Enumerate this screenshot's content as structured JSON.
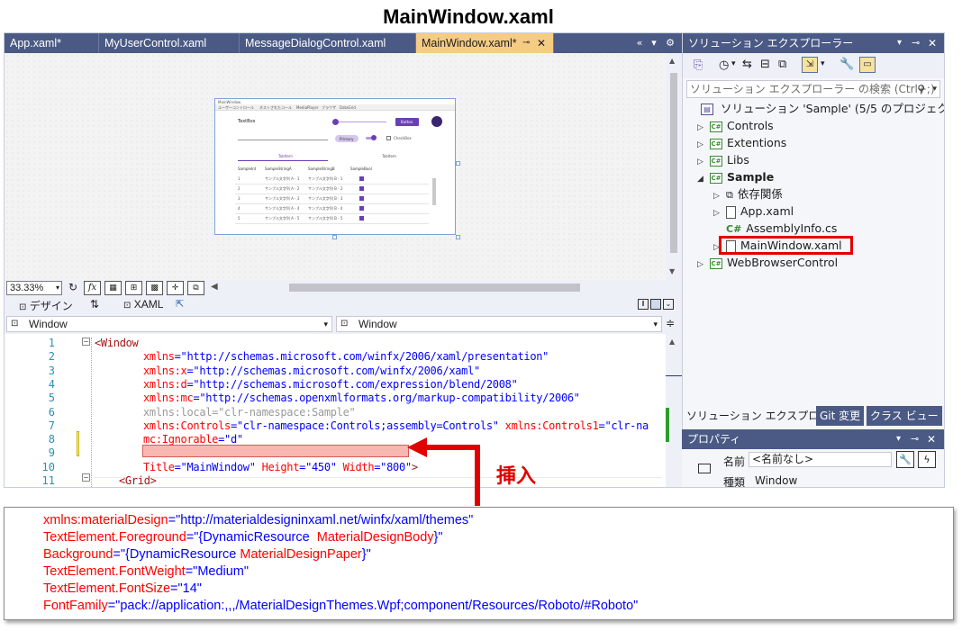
{
  "heading": "MainWindow.xaml",
  "doc_tabs": [
    {
      "label": "App.xaml*",
      "active": false
    },
    {
      "label": "MyUserControl.xaml",
      "active": false
    },
    {
      "label": "MessageDialogControl.xaml",
      "active": false
    },
    {
      "label": "MainWindow.xaml*",
      "active": true
    }
  ],
  "designer_preview": {
    "title": "MainWindow",
    "tabs": [
      "ユーザーコントロール",
      "ネストされたコール",
      "MediaPlayer",
      "ブラウザ",
      "DataGrid"
    ],
    "textbox_label": "TextBox",
    "button_label": "Button",
    "chip_label": "Primary",
    "checkbox_label": "CheckBox",
    "tab_items": [
      "TabItem",
      "TabItem"
    ],
    "grid_headers": [
      "SampleInt",
      "SampleStringA",
      "SampleStringB",
      "SampleBool"
    ],
    "grid_rows": [
      [
        "1",
        "サンプル文字列 A - 1",
        "サンプル文字列 B - 1"
      ],
      [
        "2",
        "サンプル文字列 A - 2",
        "サンプル文字列 B - 2"
      ],
      [
        "3",
        "サンプル文字列 A - 3",
        "サンプル文字列 B - 3"
      ],
      [
        "4",
        "サンプル文字列 A - 4",
        "サンプル文字列 B - 4"
      ],
      [
        "5",
        "サンプル文字列 A - 5",
        "サンプル文字列 B - 5"
      ]
    ]
  },
  "zoom_level": "33.33%",
  "view_tabs": {
    "design": "デザイン",
    "xaml": "XAML"
  },
  "dropdowns": {
    "left": "Window",
    "right": "Window"
  },
  "code_lines": [
    {
      "n": "1",
      "parts": [
        {
          "c": "kw",
          "t": "<Window"
        }
      ]
    },
    {
      "n": "2",
      "parts": [
        {
          "c": "at",
          "t": "xmlns"
        },
        {
          "c": "st",
          "t": "=\"http://schemas.microsoft.com/winfx/2006/xaml/presentation\""
        }
      ]
    },
    {
      "n": "3",
      "parts": [
        {
          "c": "at",
          "t": "xmlns:x"
        },
        {
          "c": "st",
          "t": "=\"http://schemas.microsoft.com/winfx/2006/xaml\""
        }
      ]
    },
    {
      "n": "4",
      "parts": [
        {
          "c": "at",
          "t": "xmlns:d"
        },
        {
          "c": "st",
          "t": "=\"http://schemas.microsoft.com/expression/blend/2008\""
        }
      ]
    },
    {
      "n": "5",
      "parts": [
        {
          "c": "at",
          "t": "xmlns:mc"
        },
        {
          "c": "st",
          "t": "=\"http://schemas.openxmlformats.org/markup-compatibility/2006\""
        }
      ]
    },
    {
      "n": "6",
      "parts": [
        {
          "c": "gr",
          "t": "xmlns:local=\"clr-namespace:Sample\""
        }
      ]
    },
    {
      "n": "7",
      "parts": [
        {
          "c": "at",
          "t": "xmlns:Controls"
        },
        {
          "c": "st",
          "t": "=\"clr-namespace:Controls;assembly=Controls\" "
        },
        {
          "c": "at",
          "t": "xmlns:Controls1"
        },
        {
          "c": "st",
          "t": "=\"clr-na"
        }
      ]
    },
    {
      "n": "8",
      "parts": [
        {
          "c": "at",
          "t": "mc:Ignorable"
        },
        {
          "c": "st",
          "t": "=\"d\""
        }
      ]
    },
    {
      "n": "9",
      "parts": []
    },
    {
      "n": "10",
      "parts": [
        {
          "c": "at",
          "t": "Title"
        },
        {
          "c": "st",
          "t": "=\"MainWindow\" "
        },
        {
          "c": "at",
          "t": "Height"
        },
        {
          "c": "st",
          "t": "=\"450\" "
        },
        {
          "c": "at",
          "t": "Width"
        },
        {
          "c": "st",
          "t": "=\"800\""
        },
        {
          "c": "kw",
          "t": ">"
        }
      ]
    },
    {
      "n": "11",
      "parts": [
        {
          "c": "kw",
          "t": "<Grid>"
        }
      ]
    }
  ],
  "solution_explorer": {
    "title": "ソリューション エクスプローラー",
    "search_placeholder": "ソリューション エクスプローラー の検索 (Ctrl+;)",
    "solution_label": "ソリューション 'Sample' (5/5 のプロジェクト)",
    "items": [
      {
        "label": "Controls",
        "indent": 0,
        "kind": "project",
        "expander": "▷"
      },
      {
        "label": "Extentions",
        "indent": 0,
        "kind": "project",
        "expander": "▷"
      },
      {
        "label": "Libs",
        "indent": 0,
        "kind": "project",
        "expander": "▷"
      },
      {
        "label": "Sample",
        "indent": 0,
        "kind": "project",
        "expander": "◢",
        "bold": true
      },
      {
        "label": "依存関係",
        "indent": 1,
        "kind": "deps",
        "expander": "▷"
      },
      {
        "label": "App.xaml",
        "indent": 1,
        "kind": "file",
        "expander": "▷"
      },
      {
        "label": "AssemblyInfo.cs",
        "indent": 1,
        "kind": "cs",
        "expander": ""
      },
      {
        "label": "MainWindow.xaml",
        "indent": 1,
        "kind": "file",
        "expander": "▷",
        "highlight": true
      },
      {
        "label": "WebBrowserControl",
        "indent": 0,
        "kind": "project",
        "expander": "▷"
      }
    ],
    "bottom_tabs": [
      "ソリューション エクスプローラー",
      "Git 変更",
      "クラス ビュー"
    ]
  },
  "properties": {
    "title": "プロパティ",
    "name_label": "名前",
    "name_value": "<名前なし>",
    "type_label": "種類",
    "type_value": "Window"
  },
  "insert_label": "挿入",
  "callout_lines": [
    [
      {
        "c": "a",
        "t": "xmlns:materialDesign"
      },
      {
        "c": "v",
        "t": "=\"http://materialdesigninxaml.net/winfx/xaml/themes\""
      }
    ],
    [
      {
        "c": "a",
        "t": "TextElement.Foreground"
      },
      {
        "c": "v",
        "t": "=\"{DynamicResource "
      },
      {
        "c": "a",
        "t": " MaterialDesignBody"
      },
      {
        "c": "v",
        "t": "}\""
      }
    ],
    [
      {
        "c": "a",
        "t": "Background"
      },
      {
        "c": "v",
        "t": "=\"{DynamicResource "
      },
      {
        "c": "a",
        "t": "MaterialDesignPaper"
      },
      {
        "c": "v",
        "t": "}\""
      }
    ],
    [
      {
        "c": "a",
        "t": "TextElement.FontWeight"
      },
      {
        "c": "v",
        "t": "=\"Medium\""
      }
    ],
    [
      {
        "c": "a",
        "t": "TextElement.FontSize"
      },
      {
        "c": "v",
        "t": "=\"14\""
      }
    ],
    [
      {
        "c": "a",
        "t": "FontFamily"
      },
      {
        "c": "v",
        "t": "=\"pack://application:,,,/MaterialDesignThemes.Wpf;component/Resources/Roboto/#Roboto\""
      }
    ]
  ],
  "colors": {
    "tab_bar": "#4a5a85",
    "active_tab": "#f5cc84",
    "highlight_box": "#e00000",
    "insert_band": "#f8b7b0",
    "preview_accent": "#6a3fb5"
  }
}
